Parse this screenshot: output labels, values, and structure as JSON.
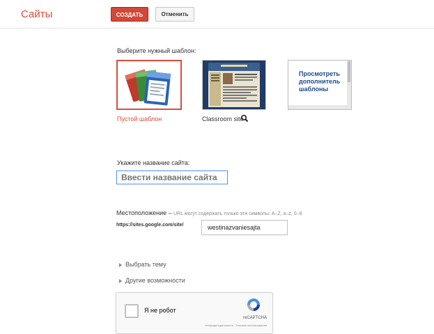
{
  "header": {
    "brand": "Сайты",
    "create_label": "СОЗДАТЬ",
    "cancel_label": "Отменить"
  },
  "templates": {
    "heading": "Выберите нужный шаблон:",
    "blank_caption": "Пустой шаблон",
    "classroom_caption": "Classroom site",
    "more_label": "Просмотреть дополнитель шаблоны",
    "zoom_icon": "magnifier-icon"
  },
  "site_name": {
    "label": "Укажите название сайта:",
    "placeholder": "Ввести название сайта"
  },
  "location": {
    "title": "Местоположение",
    "dash": " – ",
    "hint": "URL могут содержать только эти символы: A–Z, a–z, 0–9",
    "url_prefix": "https://sites.google.com/site/",
    "url_value": "westinazvaniesajta"
  },
  "options": {
    "theme": "Выбрать тему",
    "more": "Другие возможности"
  },
  "captcha": {
    "label": "Я не робот",
    "brand": "reCAPTCHA",
    "links": "Конфиденциальность - Условия использования"
  },
  "colors": {
    "accent": "#dd4b39",
    "link_blue": "#1a4a8c",
    "focus_border": "#4d90fe"
  }
}
